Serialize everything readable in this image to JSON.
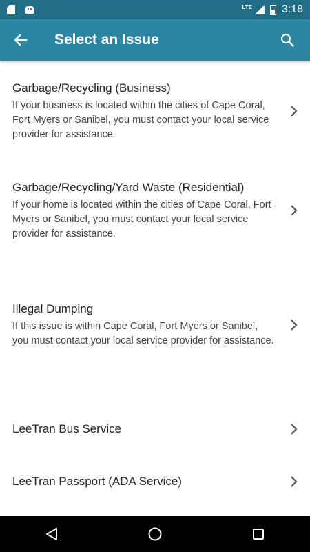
{
  "status_bar": {
    "time": "3:18",
    "network": "LTE",
    "icons": [
      "sd-card-icon",
      "android-icon",
      "signal-icon",
      "battery-icon"
    ]
  },
  "app_bar": {
    "title": "Select an Issue",
    "background": "#2a86a3",
    "status_background": "#1f6d86"
  },
  "issues": [
    {
      "title": "Garbage/Recycling (Business)",
      "description": "If your business is located within the cities of Cape Coral, Fort Myers or Sanibel, you must contact your local service provider for assistance."
    },
    {
      "title": "Garbage/Recycling/Yard Waste (Residential)",
      "description": "If your home is located within the cities of Cape Coral, Fort Myers or Sanibel, you must contact your local service provider for assistance."
    },
    {
      "title": "Illegal Dumping",
      "description": "If this issue is within Cape Coral, Fort Myers or Sanibel, you must contact your local service provider for assistance."
    },
    {
      "title": "LeeTran Bus Service"
    },
    {
      "title": "LeeTran Passport (ADA Service)"
    }
  ],
  "nav_bar": {
    "buttons": [
      "back-nav-icon",
      "home-nav-icon",
      "recents-nav-icon"
    ]
  }
}
